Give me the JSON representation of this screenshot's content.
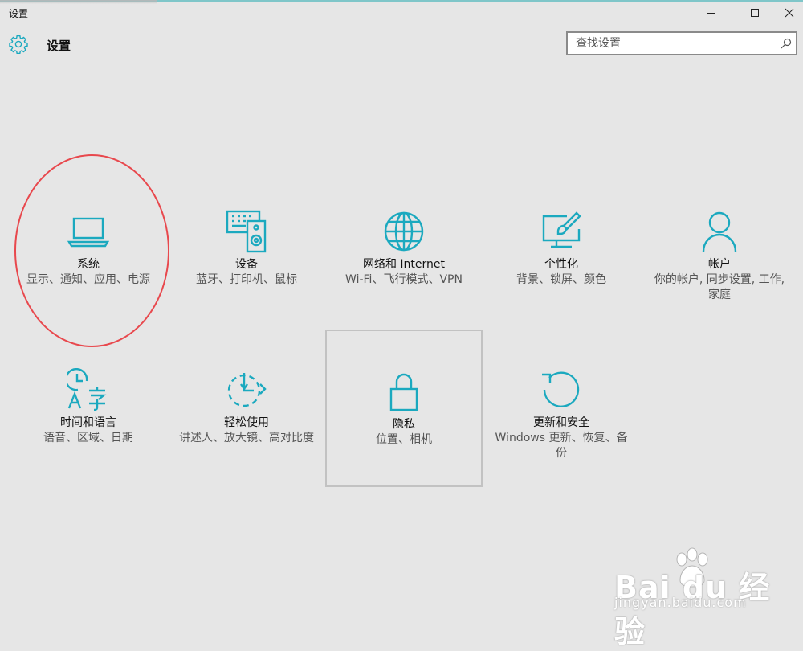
{
  "window": {
    "title": "设置",
    "minimize_glyph": "minimize-icon",
    "maximize_glyph": "maximize-icon",
    "close_glyph": "close-icon"
  },
  "header": {
    "icon": "gear-icon",
    "title": "设置"
  },
  "search": {
    "placeholder": "查找设置",
    "value": "",
    "icon": "search-icon"
  },
  "tiles": [
    {
      "icon": "laptop-icon",
      "name": "系统",
      "desc": "显示、通知、应用、电源"
    },
    {
      "icon": "devices-icon",
      "name": "设备",
      "desc": "蓝牙、打印机、鼠标"
    },
    {
      "icon": "globe-icon",
      "name": "网络和 Internet",
      "desc": "Wi-Fi、飞行模式、VPN"
    },
    {
      "icon": "personalization-icon",
      "name": "个性化",
      "desc": "背景、锁屏、颜色"
    },
    {
      "icon": "person-icon",
      "name": "帐户",
      "desc": "你的帐户, 同步设置, 工作, 家庭"
    },
    {
      "icon": "time-language-icon",
      "name": "时间和语言",
      "desc": "语音、区域、日期"
    },
    {
      "icon": "ease-of-access-icon",
      "name": "轻松使用",
      "desc": "讲述人、放大镜、高对比度"
    },
    {
      "icon": "lock-icon",
      "name": "隐私",
      "desc": "位置、相机"
    },
    {
      "icon": "update-icon",
      "name": "更新和安全",
      "desc": "Windows 更新、恢复、备份"
    }
  ],
  "watermark": {
    "brand": "Bai du 经验",
    "sub": "jingyan.baidu.com"
  },
  "colors": {
    "accent": "#1ba9bf",
    "background": "#e6e6e6",
    "annotation": "#e8484d"
  }
}
